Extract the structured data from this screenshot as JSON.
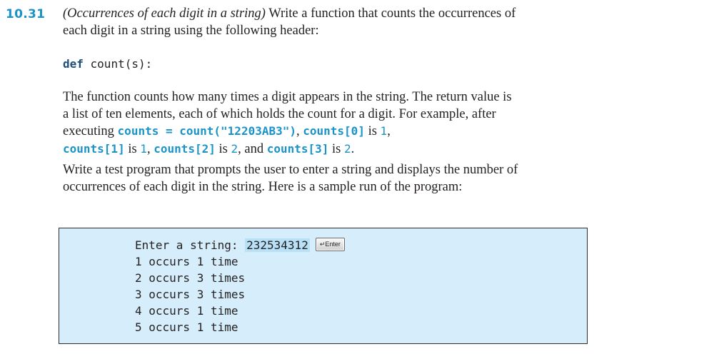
{
  "exercise": {
    "number": "10.31",
    "title": "(Occurrences of each digit in a string)",
    "intro": " Write a function that counts the occurrences of each digit in a string using the following header:"
  },
  "header": {
    "keyword": "def",
    "signature": " count(s):"
  },
  "description": {
    "text1": "The function counts how many times a digit appears in the string. The return value is a list of ten elements, each of which holds the count for a digit. For example, after executing ",
    "code1": "counts = count(\"12203AB3\")",
    "text2": ", ",
    "code2": "counts[0]",
    "text3": " is ",
    "num1": "1",
    "text4": ", ",
    "code3": "counts[1]",
    "text5": " is ",
    "num2": "1",
    "text6": ", ",
    "code4": "counts[2]",
    "text7": " is ",
    "num3": "2",
    "text8": ", and ",
    "code5": "counts[3]",
    "text9": " is ",
    "num4": "2",
    "text10": "."
  },
  "test_program": {
    "text": "Write a test program that prompts the user to enter a string and displays the number of occurrences of each digit in the string. Here is a sample run of the program:"
  },
  "sample_run": {
    "prompt": "Enter a string: ",
    "user_input": "232534312",
    "enter_key": "↵Enter",
    "outputs": [
      "1 occurs 1 time",
      "2 occurs 3 times",
      "3 occurs 3 times",
      "4 occurs 1 time",
      "5 occurs 1 time"
    ]
  }
}
